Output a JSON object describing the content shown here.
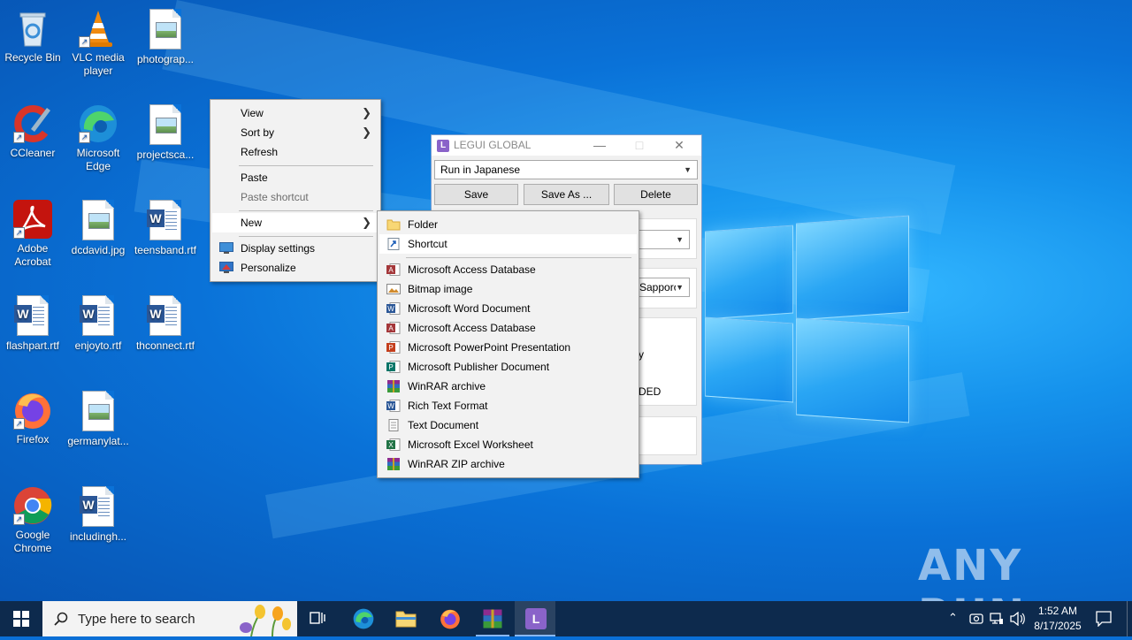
{
  "desktop": {
    "icons": [
      {
        "label": "Recycle Bin"
      },
      {
        "label": "VLC media player"
      },
      {
        "label": "photograp..."
      },
      {
        "label": "CCleaner"
      },
      {
        "label": "Microsoft Edge"
      },
      {
        "label": "projectsca..."
      },
      {
        "label": "Adobe Acrobat"
      },
      {
        "label": "dcdavid.jpg"
      },
      {
        "label": "teensband.rtf"
      },
      {
        "label": "flashpart.rtf"
      },
      {
        "label": "enjoyto.rtf"
      },
      {
        "label": "thconnect.rtf"
      },
      {
        "label": "Firefox"
      },
      {
        "label": "germanylat..."
      },
      {
        "label": "Google Chrome"
      },
      {
        "label": "includingh..."
      }
    ]
  },
  "context_menu": {
    "items": [
      {
        "label": "View"
      },
      {
        "label": "Sort by"
      },
      {
        "label": "Refresh"
      },
      {
        "label": "Paste"
      },
      {
        "label": "Paste shortcut"
      },
      {
        "label": "New"
      },
      {
        "label": "Display settings"
      },
      {
        "label": "Personalize"
      }
    ]
  },
  "new_submenu": {
    "items": [
      {
        "label": "Folder"
      },
      {
        "label": "Shortcut"
      },
      {
        "label": "Microsoft Access Database"
      },
      {
        "label": "Bitmap image"
      },
      {
        "label": "Microsoft Word Document"
      },
      {
        "label": "Microsoft Access Database"
      },
      {
        "label": "Microsoft PowerPoint Presentation"
      },
      {
        "label": "Microsoft Publisher Document"
      },
      {
        "label": "WinRAR archive"
      },
      {
        "label": "Rich Text Format"
      },
      {
        "label": "Text Document"
      },
      {
        "label": "Microsoft Excel Worksheet"
      },
      {
        "label": "WinRAR ZIP archive"
      }
    ]
  },
  "legui_window": {
    "app_icon_letter": "L",
    "title": "LEGUI GLOBAL",
    "profile_select": "Run in Japanese",
    "save_label": "Save",
    "save_as_label": "Save As ...",
    "delete_label": "Delete",
    "partial_select": "Sapporo",
    "partial_text_1": "y",
    "partial_text_2": "DED"
  },
  "taskbar": {
    "search_placeholder": "Type here to search",
    "time": "1:52 AM",
    "date": "8/17/2025"
  },
  "watermark": "ANY RUN",
  "colors": {
    "taskbar_bg": "#0d2a4d",
    "menu_bg": "#f2f2f2",
    "accent": "#8a63c9"
  }
}
